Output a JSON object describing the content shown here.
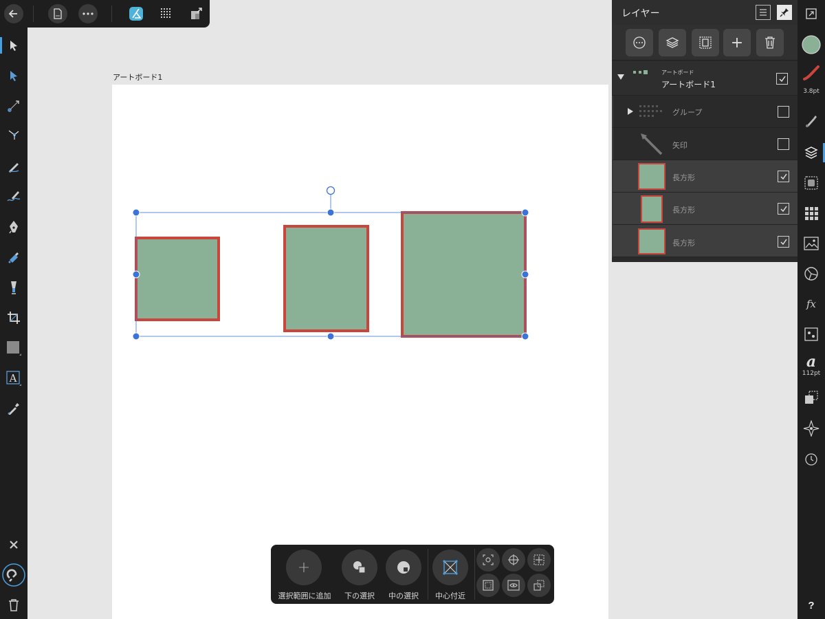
{
  "toolbar": {
    "back_icon": "back-arrow-icon",
    "document_icon": "document-icon",
    "more_icon": "more-icon"
  },
  "artboard": {
    "label": "アートボード1"
  },
  "layers": {
    "title": "レイヤー",
    "rows": [
      {
        "type_label": "アートボード",
        "name": "アートボード1",
        "checked": true
      },
      {
        "name": "グループ",
        "checked": false
      },
      {
        "name": "矢印",
        "checked": false
      },
      {
        "name": "長方形",
        "checked": true
      },
      {
        "name": "長方形",
        "checked": true
      },
      {
        "name": "長方形",
        "checked": true
      }
    ],
    "add_symbol": "+"
  },
  "right_tools": {
    "stroke_width": "3.8pt",
    "font_size": "112pt",
    "font_glyph": "a",
    "fx_label": "fx",
    "help_label": "?",
    "fill_color": "#8ab096"
  },
  "bottom_toolbar": {
    "add_symbol": "+",
    "add_to_selection": "選択範囲に追加",
    "select_under": "下の選択",
    "select_inside": "中の選択",
    "near_center": "中心付近"
  },
  "colors": {
    "shape_fill": "#8ab096",
    "shape_stroke": "#c9463d",
    "selection": "#3b74d6",
    "accent": "#4a9fe0"
  }
}
